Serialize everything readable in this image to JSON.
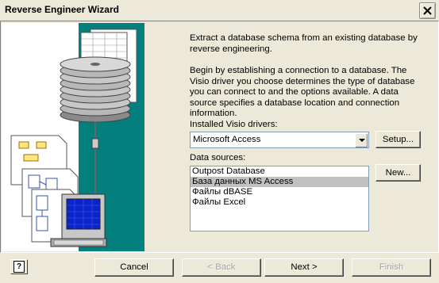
{
  "window": {
    "title": "Reverse Engineer Wizard"
  },
  "description": {
    "para1": "Extract a database schema from an existing database by reverse engineering.",
    "para2": "Begin by establishing a connection to a database.  The Visio driver you choose determines the type of database you can connect to and the options available.  A data source specifies a database location and connection information."
  },
  "drivers": {
    "label": "Installed Visio drivers:",
    "selected": "Microsoft Access",
    "setup_label": "Setup..."
  },
  "data_sources": {
    "label": "Data sources:",
    "items": [
      "Outpost Database",
      "База данных MS Access",
      "Файлы dBASE",
      "Файлы Excel"
    ],
    "selected_index": 1,
    "new_label": "New..."
  },
  "footer": {
    "help_label": "?",
    "cancel_label": "Cancel",
    "back_label": "< Back",
    "next_label": "Next >",
    "finish_label": "Finish"
  },
  "colors": {
    "art_background": "#037f7d",
    "selection": "#c0c0c0"
  }
}
